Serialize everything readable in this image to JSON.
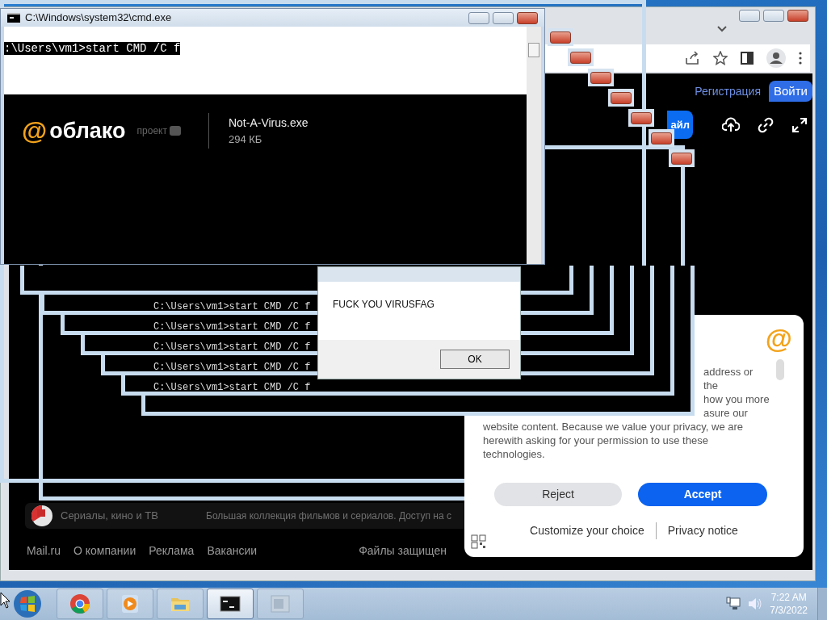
{
  "cmd_window": {
    "title": "C:\\Windows\\system32\\cmd.exe",
    "selected_line": ":\\Users\\vm1>start CMD /C f"
  },
  "cloud_header": {
    "logo_mark": "@",
    "logo_text": "облако",
    "tag": "проект",
    "file_name": "Not-A-Virus.exe",
    "file_size": "294 КБ",
    "register_link": "Регистрация",
    "login_button": "Войти",
    "download_button": "айл"
  },
  "console_lines": [
    "C:\\Users\\vm1>start CMD /C f",
    "C:\\Users\\vm1>start CMD /C f",
    "C:\\Users\\vm1>start CMD /C f",
    "C:\\Users\\vm1>start CMD /C f",
    "C:\\Users\\vm1>start CMD /C f"
  ],
  "message_box": {
    "message": "FUCK YOU VIRUSFAG",
    "button": "OK"
  },
  "cookie_dialog": {
    "logo_mark": "@",
    "text_fragments": [
      "address or",
      "the",
      "how you more",
      "asure our"
    ],
    "text": "website content. Because we value your privacy, we are herewith asking for your permission to use these technologies.",
    "reject_button": "Reject",
    "accept_button": "Accept",
    "customize_link": "Customize your choice",
    "privacy_link": "Privacy notice"
  },
  "promo_row": {
    "title": "Сериалы, кино и ТВ",
    "description": "Большая коллекция фильмов и сериалов. Доступ на с"
  },
  "footer_links": [
    "Mail.ru",
    "О компании",
    "Реклама",
    "Вакансии"
  ],
  "footer_note": "Файлы защищен",
  "taskbar": {
    "apps": [
      {
        "kind": "chrome",
        "selected": false
      },
      {
        "kind": "media",
        "selected": false
      },
      {
        "kind": "explorer",
        "selected": false
      },
      {
        "kind": "cmd",
        "selected": true
      },
      {
        "kind": "window",
        "selected": false
      }
    ],
    "time": "7:22 AM",
    "date": "7/3/2022"
  }
}
